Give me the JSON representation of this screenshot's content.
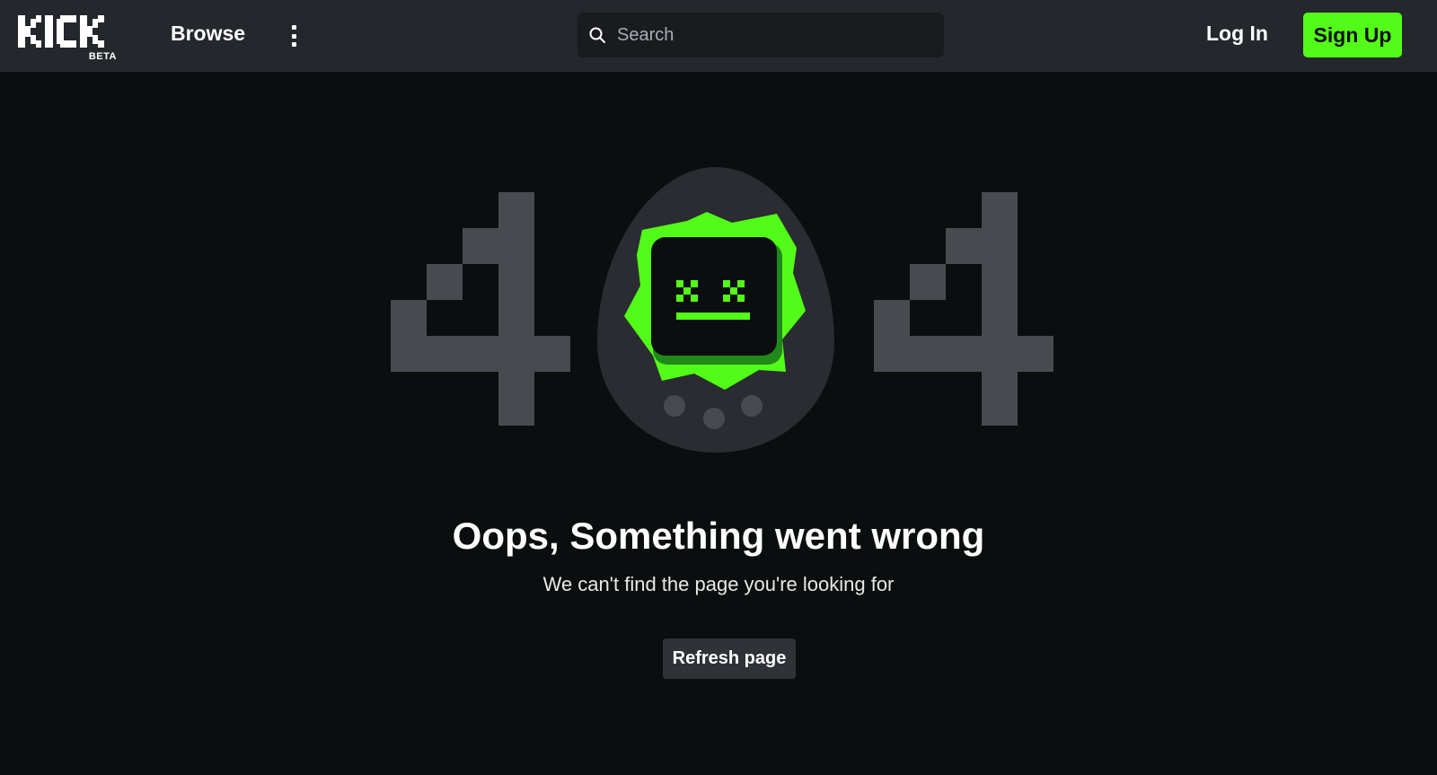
{
  "header": {
    "logo_text": "KICK",
    "logo_badge": "BETA",
    "browse_label": "Browse",
    "more_icon": "kebab-menu-icon",
    "search": {
      "placeholder": "Search",
      "value": "",
      "icon": "search-icon"
    },
    "login_label": "Log In",
    "signup_label": "Sign Up"
  },
  "error": {
    "code_digit_left": "4",
    "code_digit_right": "4",
    "mascot": "broken-tamagotchi-icon",
    "title": "Oops, Something went wrong",
    "message": "We can't find the page you're looking for",
    "refresh_label": "Refresh page"
  },
  "colors": {
    "brand_green": "#53fc18",
    "background": "#0b0e0f",
    "topbar": "#24272c",
    "digit_gray": "#474a4f"
  }
}
